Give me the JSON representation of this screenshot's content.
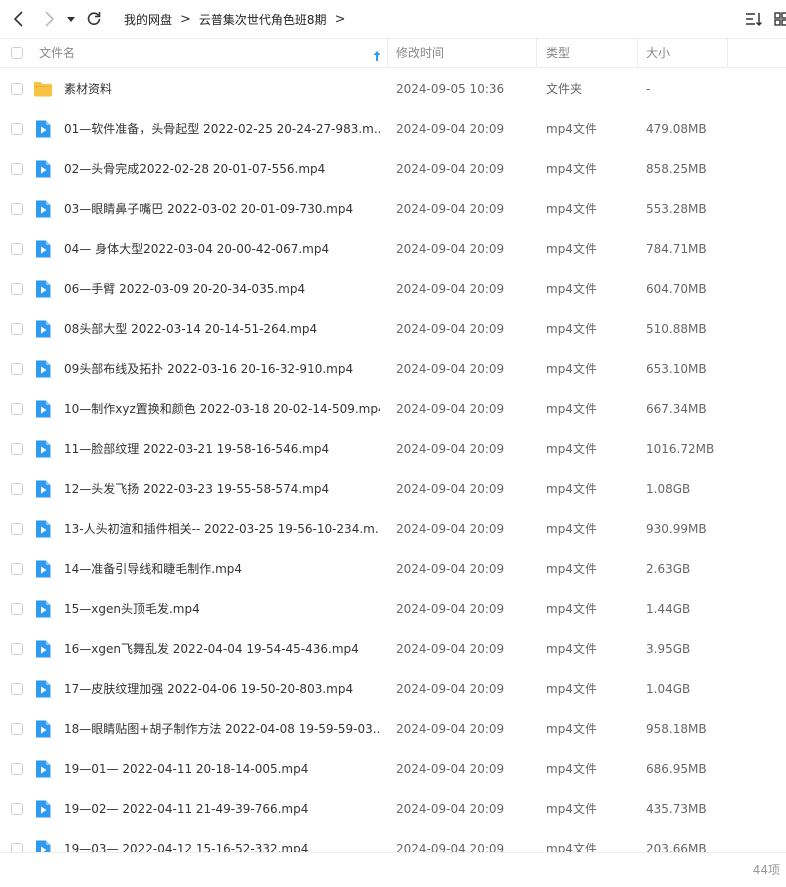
{
  "nav": {
    "breadcrumbs": [
      "我的网盘",
      "云普集次世代角色班8期"
    ]
  },
  "columns": {
    "name": "文件名",
    "modified": "修改时间",
    "type": "类型",
    "size": "大小"
  },
  "colors": {
    "folder": "#f7c343",
    "video_icon": "#2e9bf0",
    "sort_arrow": "#2e9bf0"
  },
  "files": [
    {
      "name": "素材资料",
      "modified": "2024-09-05 10:36",
      "type": "文件夹",
      "size": "-",
      "icon": "folder-icon"
    },
    {
      "name": "01—软件准备，头骨起型 2022-02-25 20-24-27-983.m...",
      "modified": "2024-09-04 20:09",
      "type": "mp4文件",
      "size": "479.08MB",
      "icon": "video-file-icon"
    },
    {
      "name": "02—头骨完成2022-02-28 20-01-07-556.mp4",
      "modified": "2024-09-04 20:09",
      "type": "mp4文件",
      "size": "858.25MB",
      "icon": "video-file-icon"
    },
    {
      "name": "03—眼睛鼻子嘴巴 2022-03-02 20-01-09-730.mp4",
      "modified": "2024-09-04 20:09",
      "type": "mp4文件",
      "size": "553.28MB",
      "icon": "video-file-icon"
    },
    {
      "name": "04— 身体大型2022-03-04 20-00-42-067.mp4",
      "modified": "2024-09-04 20:09",
      "type": "mp4文件",
      "size": "784.71MB",
      "icon": "video-file-icon"
    },
    {
      "name": "06—手臂 2022-03-09 20-20-34-035.mp4",
      "modified": "2024-09-04 20:09",
      "type": "mp4文件",
      "size": "604.70MB",
      "icon": "video-file-icon"
    },
    {
      "name": "08头部大型 2022-03-14 20-14-51-264.mp4",
      "modified": "2024-09-04 20:09",
      "type": "mp4文件",
      "size": "510.88MB",
      "icon": "video-file-icon"
    },
    {
      "name": "09头部布线及拓扑 2022-03-16 20-16-32-910.mp4",
      "modified": "2024-09-04 20:09",
      "type": "mp4文件",
      "size": "653.10MB",
      "icon": "video-file-icon"
    },
    {
      "name": "10—制作xyz置换和颜色 2022-03-18 20-02-14-509.mp4",
      "modified": "2024-09-04 20:09",
      "type": "mp4文件",
      "size": "667.34MB",
      "icon": "video-file-icon"
    },
    {
      "name": "11—脸部纹理 2022-03-21 19-58-16-546.mp4",
      "modified": "2024-09-04 20:09",
      "type": "mp4文件",
      "size": "1016.72MB",
      "icon": "video-file-icon"
    },
    {
      "name": "12—头发飞扬 2022-03-23 19-55-58-574.mp4",
      "modified": "2024-09-04 20:09",
      "type": "mp4文件",
      "size": "1.08GB",
      "icon": "video-file-icon"
    },
    {
      "name": "13-人头初渲和插件相关-- 2022-03-25 19-56-10-234.m...",
      "modified": "2024-09-04 20:09",
      "type": "mp4文件",
      "size": "930.99MB",
      "icon": "video-file-icon"
    },
    {
      "name": "14—准备引导线和睫毛制作.mp4",
      "modified": "2024-09-04 20:09",
      "type": "mp4文件",
      "size": "2.63GB",
      "icon": "video-file-icon"
    },
    {
      "name": "15—xgen头顶毛发.mp4",
      "modified": "2024-09-04 20:09",
      "type": "mp4文件",
      "size": "1.44GB",
      "icon": "video-file-icon"
    },
    {
      "name": "16—xgen飞舞乱发 2022-04-04 19-54-45-436.mp4",
      "modified": "2024-09-04 20:09",
      "type": "mp4文件",
      "size": "3.95GB",
      "icon": "video-file-icon"
    },
    {
      "name": "17—皮肤纹理加强 2022-04-06 19-50-20-803.mp4",
      "modified": "2024-09-04 20:09",
      "type": "mp4文件",
      "size": "1.04GB",
      "icon": "video-file-icon"
    },
    {
      "name": "18—眼睛贴图+胡子制作方法 2022-04-08 19-59-59-03...",
      "modified": "2024-09-04 20:09",
      "type": "mp4文件",
      "size": "958.18MB",
      "icon": "video-file-icon"
    },
    {
      "name": "19—01— 2022-04-11 20-18-14-005.mp4",
      "modified": "2024-09-04 20:09",
      "type": "mp4文件",
      "size": "686.95MB",
      "icon": "video-file-icon"
    },
    {
      "name": "19—02— 2022-04-11 21-49-39-766.mp4",
      "modified": "2024-09-04 20:09",
      "type": "mp4文件",
      "size": "435.73MB",
      "icon": "video-file-icon"
    },
    {
      "name": "19—03— 2022-04-12 15-16-52-332.mp4",
      "modified": "2024-09-04 20:09",
      "type": "mp4文件",
      "size": "203.66MB",
      "icon": "video-file-icon"
    }
  ],
  "footer": {
    "count": "44项"
  }
}
